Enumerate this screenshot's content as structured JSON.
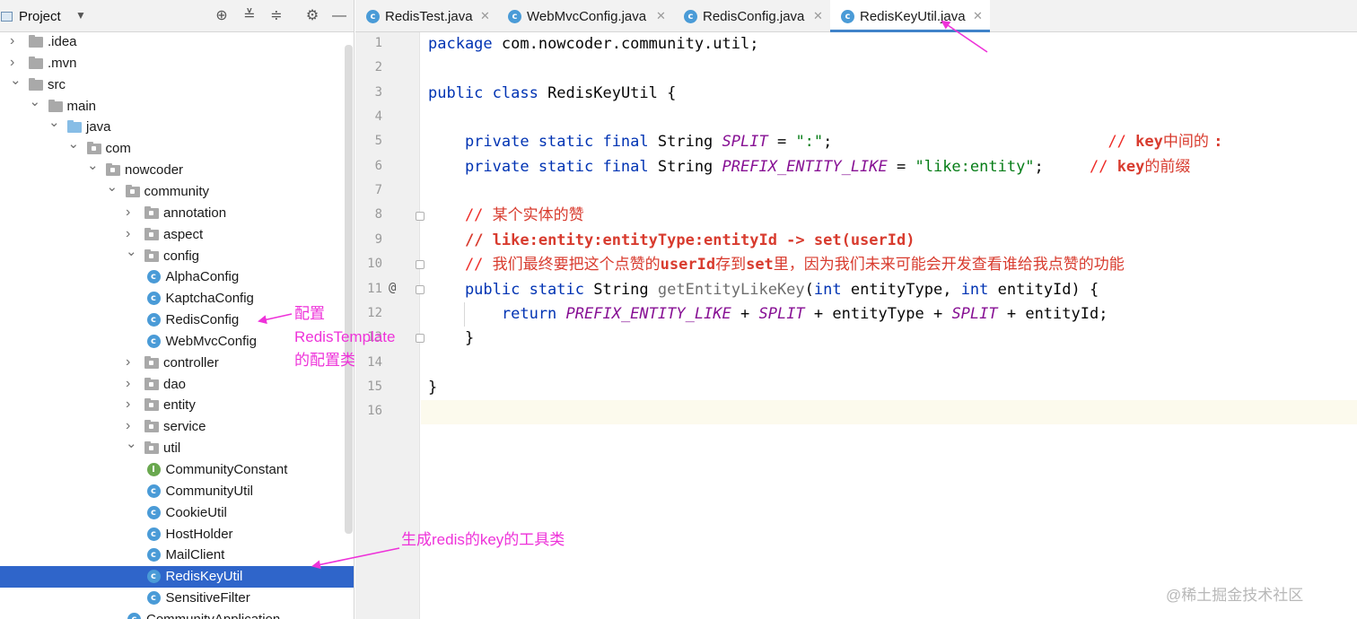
{
  "project_panel": {
    "title": "Project",
    "tree": [
      {
        "label": ".idea",
        "indent": 0,
        "kind": "folder",
        "arrow": "collapsed"
      },
      {
        "label": ".mvn",
        "indent": 0,
        "kind": "folder",
        "arrow": "collapsed"
      },
      {
        "label": "src",
        "indent": 0,
        "kind": "folder",
        "arrow": "expanded"
      },
      {
        "label": "main",
        "indent": 1,
        "kind": "folder",
        "arrow": "expanded"
      },
      {
        "label": "java",
        "indent": 2,
        "kind": "source-folder",
        "arrow": "expanded"
      },
      {
        "label": "com",
        "indent": 3,
        "kind": "package",
        "arrow": "expanded"
      },
      {
        "label": "nowcoder",
        "indent": 4,
        "kind": "package",
        "arrow": "expanded"
      },
      {
        "label": "community",
        "indent": 5,
        "kind": "package",
        "arrow": "expanded"
      },
      {
        "label": "annotation",
        "indent": 6,
        "kind": "package",
        "arrow": "collapsed"
      },
      {
        "label": "aspect",
        "indent": 6,
        "kind": "package",
        "arrow": "collapsed"
      },
      {
        "label": "config",
        "indent": 6,
        "kind": "package",
        "arrow": "expanded"
      },
      {
        "label": "AlphaConfig",
        "indent": 7,
        "kind": "class",
        "arrow": "none"
      },
      {
        "label": "KaptchaConfig",
        "indent": 7,
        "kind": "class",
        "arrow": "none"
      },
      {
        "label": "RedisConfig",
        "indent": 7,
        "kind": "class",
        "arrow": "none"
      },
      {
        "label": "WebMvcConfig",
        "indent": 7,
        "kind": "class",
        "arrow": "none"
      },
      {
        "label": "controller",
        "indent": 6,
        "kind": "package",
        "arrow": "collapsed"
      },
      {
        "label": "dao",
        "indent": 6,
        "kind": "package",
        "arrow": "collapsed"
      },
      {
        "label": "entity",
        "indent": 6,
        "kind": "package",
        "arrow": "collapsed"
      },
      {
        "label": "service",
        "indent": 6,
        "kind": "package",
        "arrow": "collapsed"
      },
      {
        "label": "util",
        "indent": 6,
        "kind": "package",
        "arrow": "expanded"
      },
      {
        "label": "CommunityConstant",
        "indent": 7,
        "kind": "interface",
        "arrow": "none"
      },
      {
        "label": "CommunityUtil",
        "indent": 7,
        "kind": "class",
        "arrow": "none"
      },
      {
        "label": "CookieUtil",
        "indent": 7,
        "kind": "class",
        "arrow": "none"
      },
      {
        "label": "HostHolder",
        "indent": 7,
        "kind": "class",
        "arrow": "none"
      },
      {
        "label": "MailClient",
        "indent": 7,
        "kind": "class",
        "arrow": "none"
      },
      {
        "label": "RedisKeyUtil",
        "indent": 7,
        "kind": "class",
        "arrow": "none",
        "selected": true
      },
      {
        "label": "SensitiveFilter",
        "indent": 7,
        "kind": "class",
        "arrow": "none"
      },
      {
        "label": "CommunityApplication",
        "indent": 6,
        "kind": "class",
        "arrow": "none"
      }
    ]
  },
  "tabs": [
    {
      "label": "RedisTest.java",
      "icon": "java-class-icon",
      "active": false
    },
    {
      "label": "WebMvcConfig.java",
      "icon": "java-class-icon",
      "active": false
    },
    {
      "label": "RedisConfig.java",
      "icon": "java-class-icon",
      "active": false
    },
    {
      "label": "RedisKeyUtil.java",
      "icon": "java-class-icon",
      "active": true
    }
  ],
  "editor": {
    "line_numbers": [
      "1",
      "2",
      "3",
      "4",
      "5",
      "6",
      "7",
      "8",
      "9",
      "10",
      "11",
      "12",
      "13",
      "14",
      "15",
      "16"
    ],
    "line_9_comment": "// like:entity:entityType:entityId -> set(userId)",
    "lines": [
      [
        {
          "t": "package ",
          "c": "kw"
        },
        {
          "t": "com.nowcoder.community.util;",
          "c": ""
        }
      ],
      [],
      [
        {
          "t": "public class ",
          "c": "kw"
        },
        {
          "t": "RedisKeyUtil {",
          "c": ""
        }
      ],
      [],
      [
        {
          "t": "    private static final ",
          "c": "kw"
        },
        {
          "t": "String ",
          "c": ""
        },
        {
          "t": "SPLIT",
          "c": "cst"
        },
        {
          "t": " = ",
          "c": ""
        },
        {
          "t": "\":\"",
          "c": "str"
        },
        {
          "t": ";                              ",
          "c": ""
        },
        {
          "t": "// ",
          "c": "cmt"
        },
        {
          "t": "key",
          "c": "cmt-b"
        },
        {
          "t": "中间的 ",
          "c": "cmt-zh"
        },
        {
          "t": ":",
          "c": "cmt-b"
        }
      ],
      [
        {
          "t": "    private static final ",
          "c": "kw"
        },
        {
          "t": "String ",
          "c": ""
        },
        {
          "t": "PREFIX_ENTITY_LIKE",
          "c": "cst"
        },
        {
          "t": " = ",
          "c": ""
        },
        {
          "t": "\"like:entity\"",
          "c": "str"
        },
        {
          "t": ";     ",
          "c": ""
        },
        {
          "t": "// ",
          "c": "cmt"
        },
        {
          "t": "key",
          "c": "cmt-b"
        },
        {
          "t": "的前缀",
          "c": "cmt-zh"
        }
      ],
      [],
      [
        {
          "t": "    // ",
          "c": "cmt"
        },
        {
          "t": "某个实体的赞",
          "c": "cmt-zh"
        }
      ],
      [
        {
          "t": "    ",
          "c": ""
        },
        {
          "t": "// like:entity:entityType:entityId -> set(userId)",
          "c": "cmt-b"
        }
      ],
      [
        {
          "t": "    // ",
          "c": "cmt"
        },
        {
          "t": "我们最终要把这个点赞的",
          "c": "cmt-zh"
        },
        {
          "t": "userId",
          "c": "cmt-b"
        },
        {
          "t": "存到",
          "c": "cmt-zh"
        },
        {
          "t": "set",
          "c": "cmt-b"
        },
        {
          "t": "里，因为我们未来可能会开发查看谁给我点赞的功能",
          "c": "cmt-zh"
        }
      ],
      [
        {
          "t": "    public static ",
          "c": "kw"
        },
        {
          "t": "String ",
          "c": ""
        },
        {
          "t": "getEntityLikeKey",
          "c": "mth"
        },
        {
          "t": "(",
          "c": ""
        },
        {
          "t": "int ",
          "c": "kw"
        },
        {
          "t": "entityType, ",
          "c": ""
        },
        {
          "t": "int ",
          "c": "kw"
        },
        {
          "t": "entityId) {",
          "c": ""
        }
      ],
      [
        {
          "t": "        return ",
          "c": "kw"
        },
        {
          "t": "PREFIX_ENTITY_LIKE",
          "c": "cst"
        },
        {
          "t": " + ",
          "c": ""
        },
        {
          "t": "SPLIT",
          "c": "cst"
        },
        {
          "t": " + entityType + ",
          "c": ""
        },
        {
          "t": "SPLIT",
          "c": "cst"
        },
        {
          "t": " + entityId;",
          "c": ""
        }
      ],
      [
        {
          "t": "    }",
          "c": ""
        }
      ],
      [],
      [
        {
          "t": "}",
          "c": ""
        }
      ],
      []
    ]
  },
  "annotations": {
    "redis_config_note": [
      "配置",
      "RedisTemplate",
      "的配置类"
    ],
    "redis_key_util_note": "生成redis的key的工具类",
    "color": "#ee32d9"
  },
  "watermark": "@稀土掘金技术社区",
  "colors": {
    "selection": "#2f65ca",
    "keyword": "#0033b3",
    "string": "#067d17",
    "constant": "#871094",
    "comment": "#d83b2e"
  }
}
